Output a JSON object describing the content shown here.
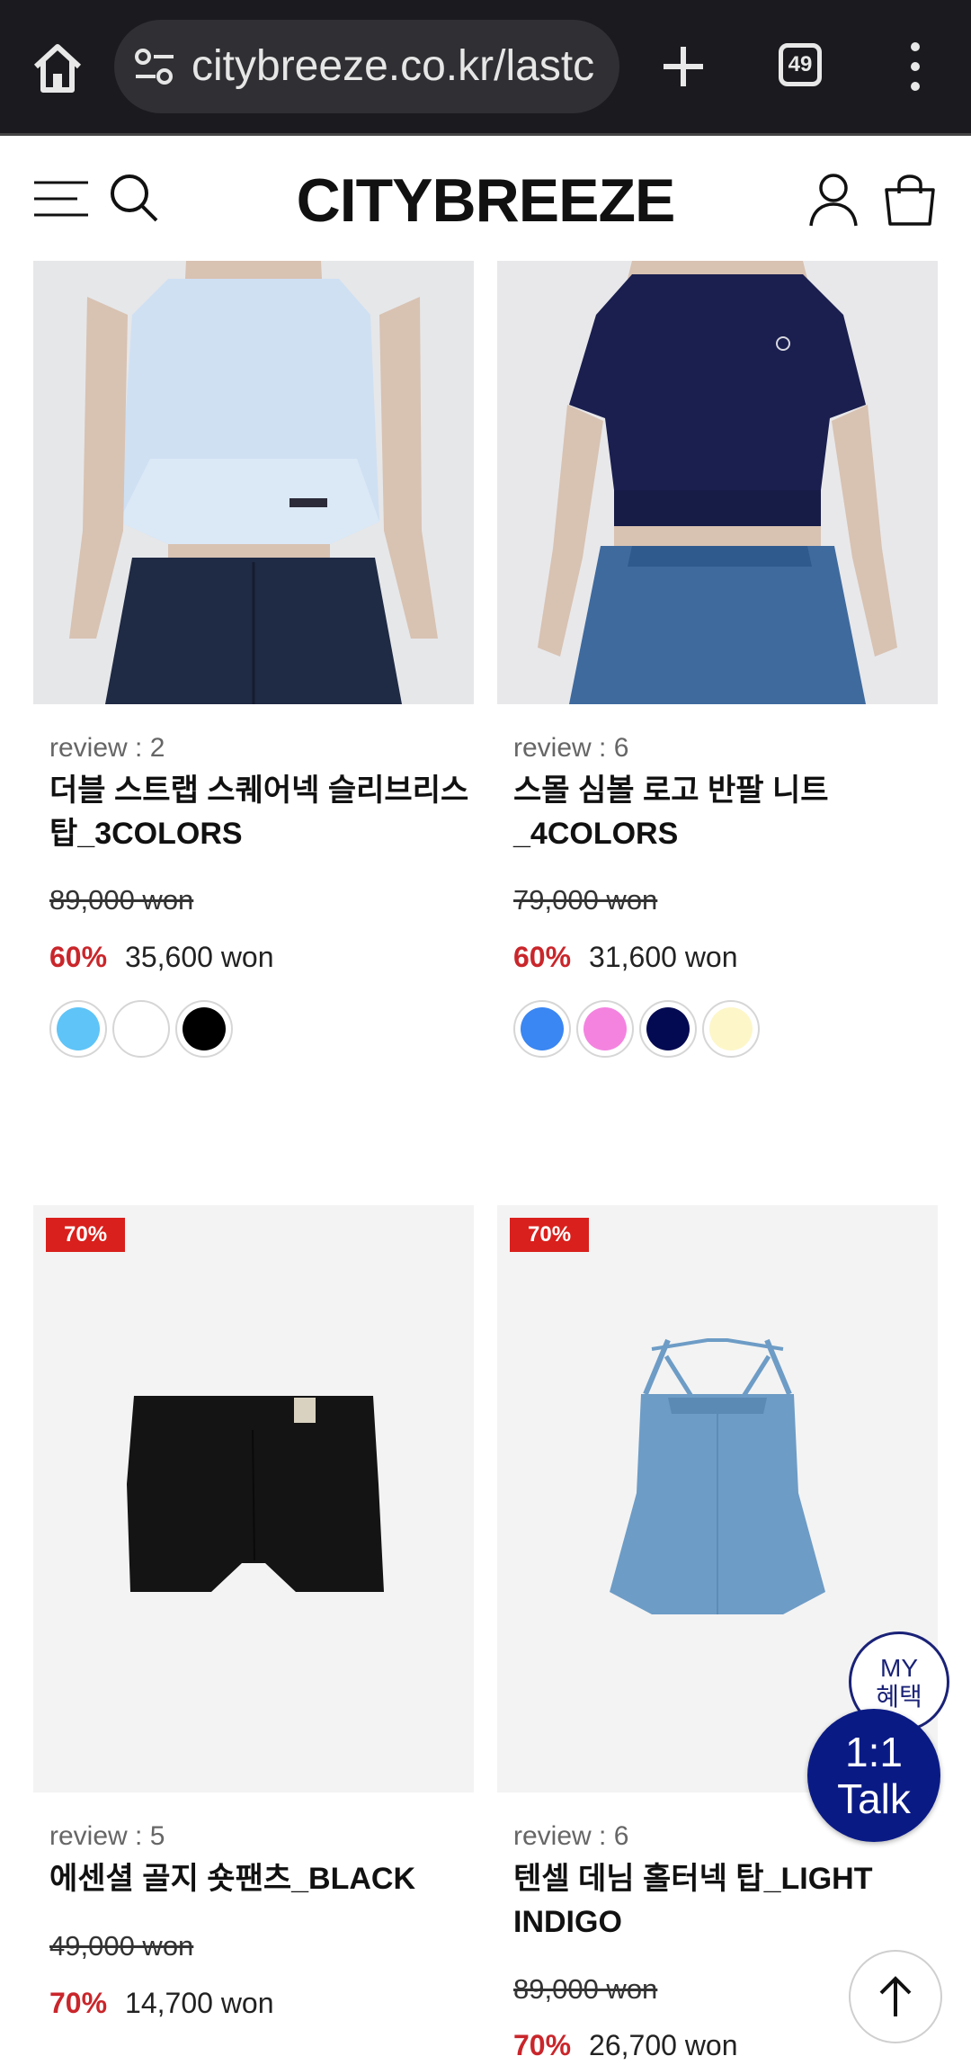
{
  "browser": {
    "url": "citybreeze.co.kr/lastc",
    "tab_count": "49"
  },
  "site": {
    "logo": "CITYBREEZE"
  },
  "products": [
    {
      "review": "review : 2",
      "name": "더블 스트랩 스퀘어넥 슬리브리스 탑_3COLORS",
      "original_price": "89,000 won",
      "discount": "60%",
      "sale_price": "35,600 won",
      "swatches": [
        "#5fc4f7",
        "#ffffff",
        "#000000"
      ]
    },
    {
      "review": "review : 6",
      "name": "스몰 심볼 로고 반팔 니트 _4COLORS",
      "original_price": "79,000 won",
      "discount": "60%",
      "sale_price": "31,600 won",
      "swatches": [
        "#3a86f2",
        "#f483e0",
        "#040a52",
        "#fdf6c8"
      ]
    },
    {
      "badge": "70%",
      "review": "review : 5",
      "name": "에센셜 골지 숏팬츠_BLACK",
      "original_price": "49,000 won",
      "discount": "70%",
      "sale_price": "14,700 won"
    },
    {
      "badge": "70%",
      "review": "review : 6",
      "name": "텐셀 데님 홀터넥 탑_LIGHT INDIGO",
      "original_price": "89,000 won",
      "discount": "70%",
      "sale_price": "26,700 won"
    }
  ],
  "floating": {
    "my_benefit": "MY 혜택",
    "talk": "1:1 Talk"
  }
}
